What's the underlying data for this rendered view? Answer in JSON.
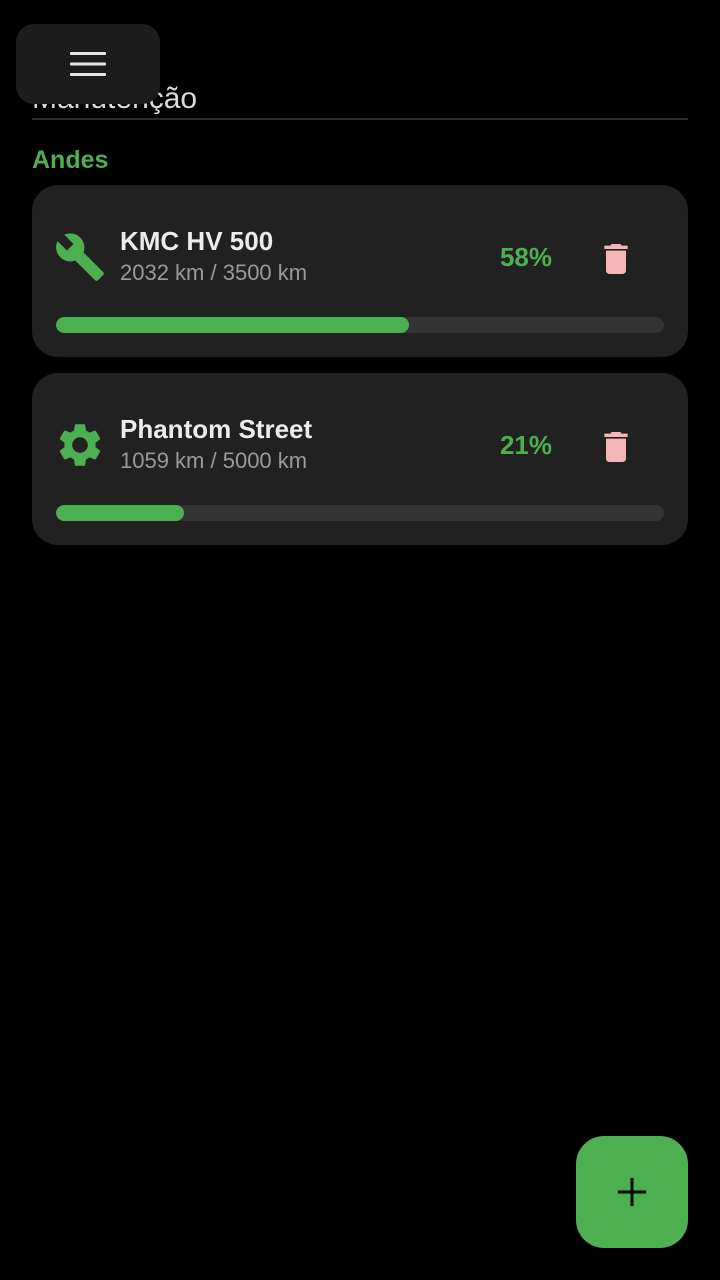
{
  "header": {
    "title": "Manutenção",
    "menu_icon": "hamburger-menu-icon"
  },
  "section": {
    "label": "Andes"
  },
  "colors": {
    "accent": "#4caf50",
    "card_background": "#212121",
    "delete": "#f4b6b6",
    "track": "#333333"
  },
  "items": [
    {
      "name": "KMC HV 500",
      "distance": "2032 km / 3500 km",
      "percent": "58%",
      "progress": 0.58,
      "icon": "wrench-icon",
      "delete_icon": "trash-icon"
    },
    {
      "name": "Phantom Street",
      "distance": "1059 km / 5000 km",
      "percent": "21%",
      "progress": 0.21,
      "icon": "gear-icon",
      "delete_icon": "trash-icon"
    }
  ],
  "fab": {
    "icon": "plus-icon"
  }
}
